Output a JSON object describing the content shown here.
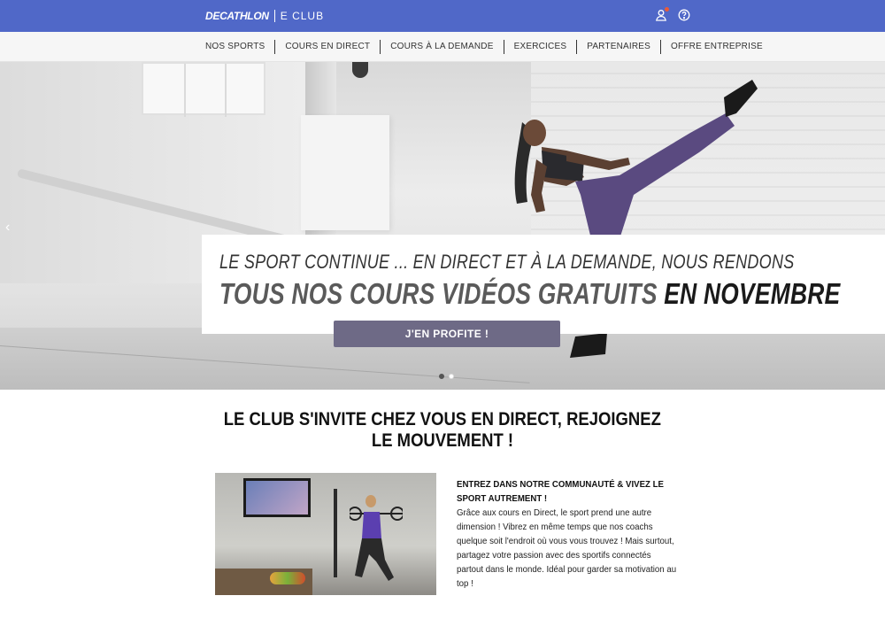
{
  "header": {
    "brand_logo": "DECATHLON",
    "brand_club": "E CLUB",
    "icons": [
      "user-icon",
      "help-circle-icon"
    ],
    "accent_color": "#5068c8",
    "notification_color": "#e85a3a"
  },
  "nav": {
    "items": [
      {
        "label": "NOS SPORTS"
      },
      {
        "label": "COURS EN DIRECT"
      },
      {
        "label": "COURS À LA DEMANDE"
      },
      {
        "label": "EXERCICES"
      },
      {
        "label": "PARTENAIRES"
      },
      {
        "label": "OFFRE ENTREPRISE"
      }
    ]
  },
  "hero": {
    "line1": "LE SPORT CONTINUE ... EN DIRECT ET À LA DEMANDE, NOUS RENDONS",
    "line2_gray": "TOUS NOS COURS VIDÉOS GRATUITS",
    "line2_dark": "EN NOVEMBRE",
    "cta_label": "J'EN PROFITE !",
    "cta_color": "#6e6a86",
    "prev_arrow": "‹",
    "slides_total": 2,
    "slide_active": 1
  },
  "section": {
    "title_line1": "LE CLUB S'INVITE CHEZ VOUS EN DIRECT, REJOIGNEZ",
    "title_line2": "LE MOUVEMENT !",
    "text_head": "ENTREZ DANS NOTRE COMMUNAUTÉ & VIVEZ LE SPORT AUTREMENT !",
    "text_body": "Grâce aux cours en Direct, le sport prend une autre dimension ! Vibrez en même temps que nos coachs quelque soit l'endroit où vous vous trouvez ! Mais surtout, partagez votre passion avec des sportifs connectés partout dans le monde. Idéal pour garder sa motivation au top !"
  }
}
